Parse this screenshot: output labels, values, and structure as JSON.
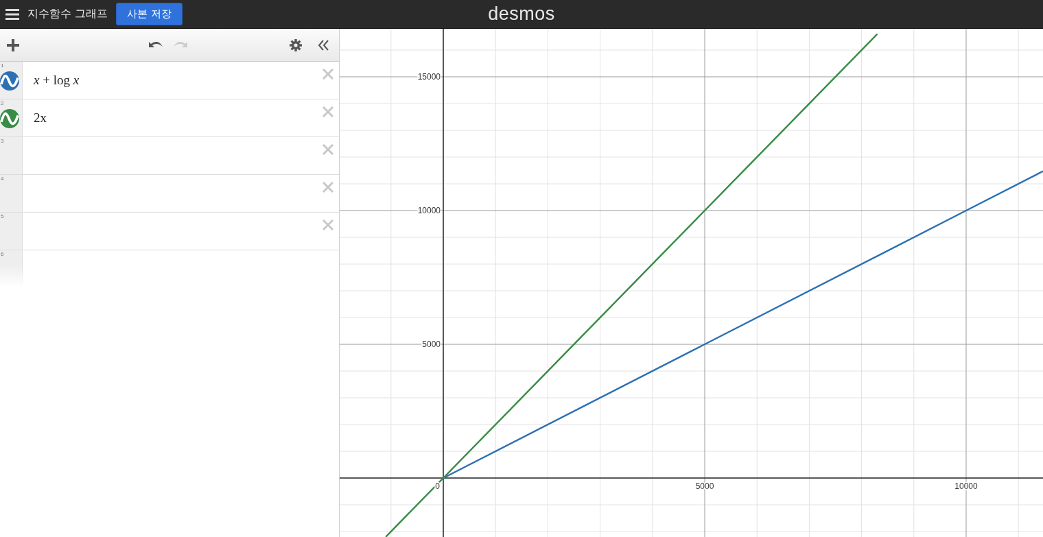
{
  "header": {
    "title": "지수함수 그래프",
    "save_button": "사본 저장",
    "logo": "desmos"
  },
  "toolbar": {
    "undo": {
      "disabled": false
    },
    "redo": {
      "disabled": true
    }
  },
  "expressions": [
    {
      "kind": "expression",
      "index": "1",
      "expression": "*x* + log *x*",
      "color": "#2d70b3"
    },
    {
      "kind": "expression",
      "index": "2",
      "expression": "2x",
      "color": "#388c46"
    },
    {
      "kind": "empty",
      "index": "3"
    },
    {
      "kind": "empty",
      "index": "4"
    },
    {
      "kind": "empty",
      "index": "5"
    },
    {
      "kind": "new",
      "index": "6"
    }
  ],
  "graph": {
    "chart_data": {
      "type": "line",
      "grid": true,
      "xlim": [
        -1982,
        11470
      ],
      "ylim": [
        -2205,
        16795
      ],
      "xticks": [
        0,
        5000,
        10000
      ],
      "yticks": [
        5000,
        10000,
        15000
      ],
      "x": [
        -1100,
        0,
        5000,
        8300,
        10000,
        11470
      ],
      "series": [
        {
          "color": "#2d70b3",
          "values": [
            null,
            0,
            5000,
            8300,
            10000,
            11470
          ]
        },
        {
          "color": "#388c46",
          "values": [
            -2200,
            0,
            10000,
            16600,
            null,
            null
          ]
        }
      ]
    }
  }
}
